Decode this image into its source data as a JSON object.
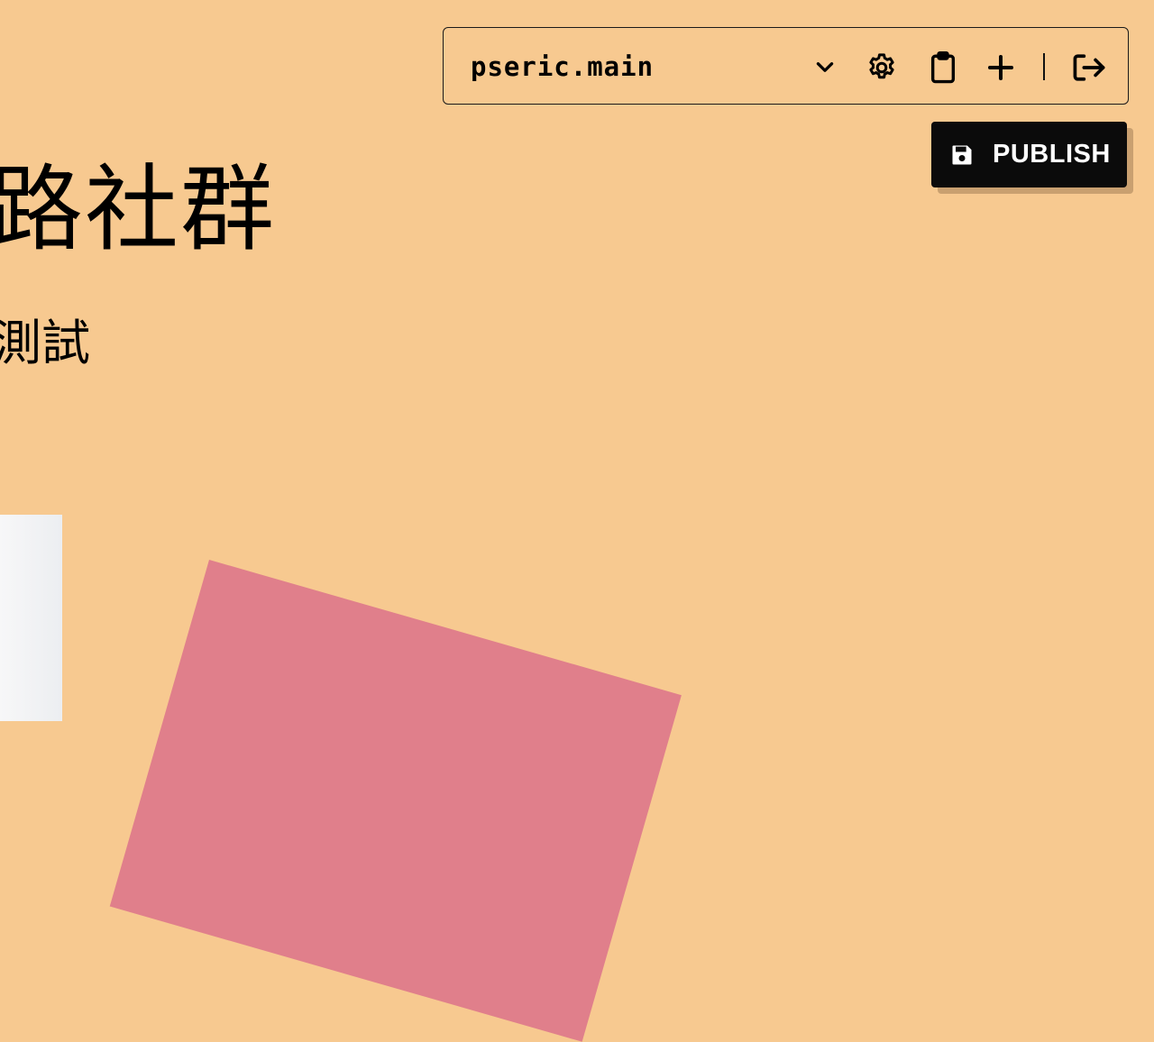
{
  "hero": {
    "title": "路社群",
    "subtitle": "測試"
  },
  "toolbar": {
    "site_name": "pseric.main",
    "icons": [
      "chevron-down-icon",
      "gear-icon",
      "clipboard-icon",
      "plus-icon",
      "logout-icon"
    ]
  },
  "publish": {
    "label": "PUBLISH",
    "icon": "floppy-disk-icon"
  },
  "colors": {
    "background": "#f7c990",
    "accent_shape": "#e07f8b",
    "button_bg": "#0b0b0b",
    "button_text": "#ffffff"
  }
}
